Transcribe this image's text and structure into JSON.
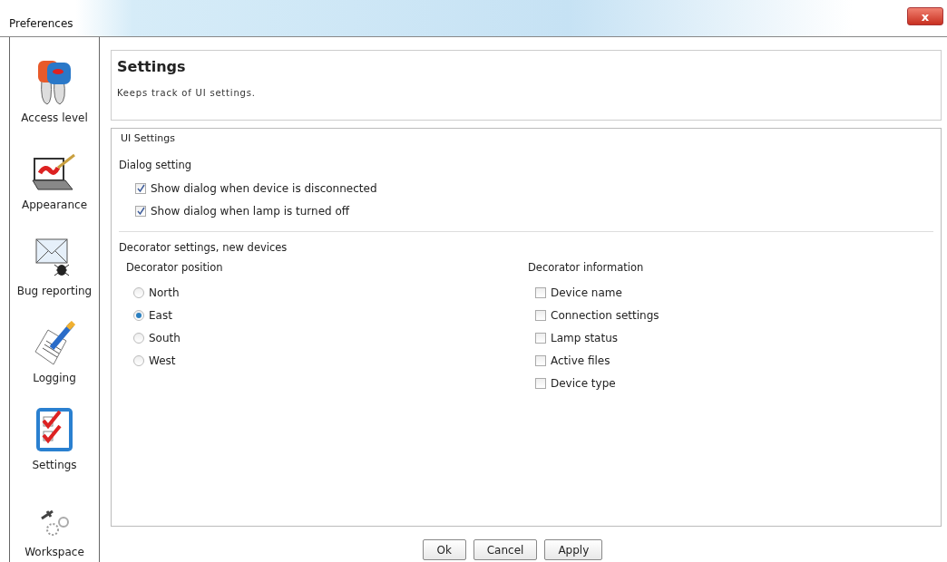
{
  "window": {
    "title": "Preferences",
    "close_label": "x"
  },
  "sidebar": {
    "items": [
      {
        "label": "Access level",
        "kind": "keys"
      },
      {
        "label": "Appearance",
        "kind": "laptop"
      },
      {
        "label": "Bug reporting",
        "kind": "mail"
      },
      {
        "label": "Logging",
        "kind": "pencil"
      },
      {
        "label": "Settings",
        "kind": "checklist"
      },
      {
        "label": "Workspace",
        "kind": "tools"
      }
    ]
  },
  "header": {
    "title": "Settings",
    "description": "Keeps track of UI settings."
  },
  "group": {
    "title": "UI Settings",
    "dialog_section": {
      "title": "Dialog setting",
      "options": [
        {
          "label": "Show dialog when device is disconnected",
          "checked": true
        },
        {
          "label": "Show dialog when lamp is turned off",
          "checked": true
        }
      ]
    },
    "decorator_section": {
      "title": "Decorator settings, new devices",
      "position": {
        "title": "Decorator position",
        "options": [
          {
            "label": "North",
            "selected": false
          },
          {
            "label": "East",
            "selected": true
          },
          {
            "label": "South",
            "selected": false
          },
          {
            "label": "West",
            "selected": false
          }
        ]
      },
      "information": {
        "title": "Decorator information",
        "options": [
          {
            "label": "Device name",
            "checked": false
          },
          {
            "label": "Connection settings",
            "checked": false
          },
          {
            "label": "Lamp status",
            "checked": false
          },
          {
            "label": "Active files",
            "checked": false
          },
          {
            "label": "Device type",
            "checked": false
          }
        ]
      }
    }
  },
  "buttons": [
    "Ok",
    "Cancel",
    "Apply"
  ]
}
